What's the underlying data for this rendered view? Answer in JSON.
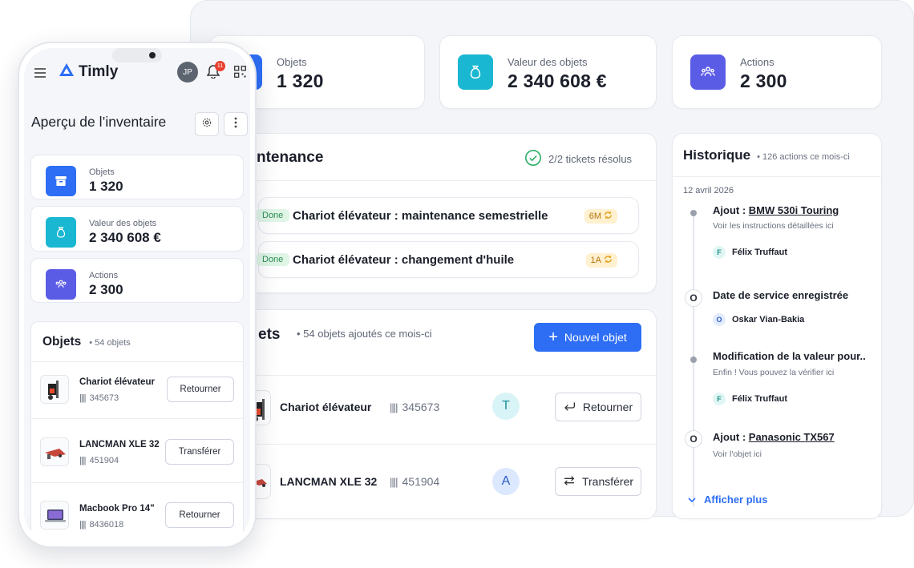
{
  "desktop": {
    "stats": [
      {
        "label": "Objets",
        "value": "1 320",
        "icon": "archive-box-icon"
      },
      {
        "label": "Valeur des objets",
        "value": "2 340 608 €",
        "icon": "money-bag-icon"
      },
      {
        "label": "Actions",
        "value": "2 300",
        "icon": "users-group-icon"
      }
    ],
    "maintenance": {
      "title_partial": "ntenance",
      "resolved": "2/2 tickets résolus",
      "tickets": [
        {
          "status": "Done",
          "title": "Chariot élévateur : maintenance semestrielle",
          "badge": "6M"
        },
        {
          "status": "Done",
          "title": "Chariot élévateur : changement d'huile",
          "badge": "1A"
        }
      ]
    },
    "objects": {
      "title_partial": "ets",
      "added": "54 objets ajoutés ce mois-ci",
      "new_button": "Nouvel objet",
      "rows": [
        {
          "name": "Chariot élévateur",
          "code": "345673",
          "avatar": "T",
          "action": "Retourner"
        },
        {
          "name": "LANCMAN XLE 32",
          "code": "451904",
          "avatar": "A",
          "action": "Transférer"
        }
      ]
    },
    "history": {
      "title": "Historique",
      "count": "126 actions ce mois-ci",
      "date": "12 avril 2026",
      "entries": [
        {
          "prefix": "Ajout :",
          "link": "BMW 530i Touring",
          "sub": "Voir les instructions détaillées ici",
          "user": "Félix Truffaut",
          "user_initial": "F"
        },
        {
          "title": "Date de service enregistrée",
          "user": "Oskar Vian-Bakia",
          "user_initial": "O",
          "marker": "O"
        },
        {
          "title": "Modification de la valeur pour..",
          "sub": "Enfin ! Vous pouvez la vérifier ici",
          "user": "Félix Truffaut",
          "user_initial": "F"
        },
        {
          "prefix": "Ajout :",
          "link": "Panasonic TX567",
          "sub": "Voir l'objet ici",
          "marker": "O"
        }
      ],
      "more": "Afficher plus"
    }
  },
  "phone": {
    "brand": "Timly",
    "user_initials": "JP",
    "notifications": "11",
    "page_title": "Aperçu de l’inventaire",
    "stats": [
      {
        "label": "Objets",
        "value": "1 320"
      },
      {
        "label": "Valeur des objets",
        "value": "2 340 608 €"
      },
      {
        "label": "Actions",
        "value": "2 300"
      }
    ],
    "objects_title": "Objets",
    "objects_count": "54 objets",
    "items": [
      {
        "name": "Chariot élévateur",
        "code": "345673",
        "action": "Retourner"
      },
      {
        "name": "LANCMAN XLE 32",
        "code": "451904",
        "action": "Transférer"
      },
      {
        "name": "Macbook Pro 14\"",
        "code": "8436018",
        "action": "Retourner"
      }
    ]
  },
  "colors": {
    "primary": "#2d6ef5",
    "teal": "#19b7d1",
    "violet": "#5b5ce6",
    "success": "#2f8f54"
  }
}
